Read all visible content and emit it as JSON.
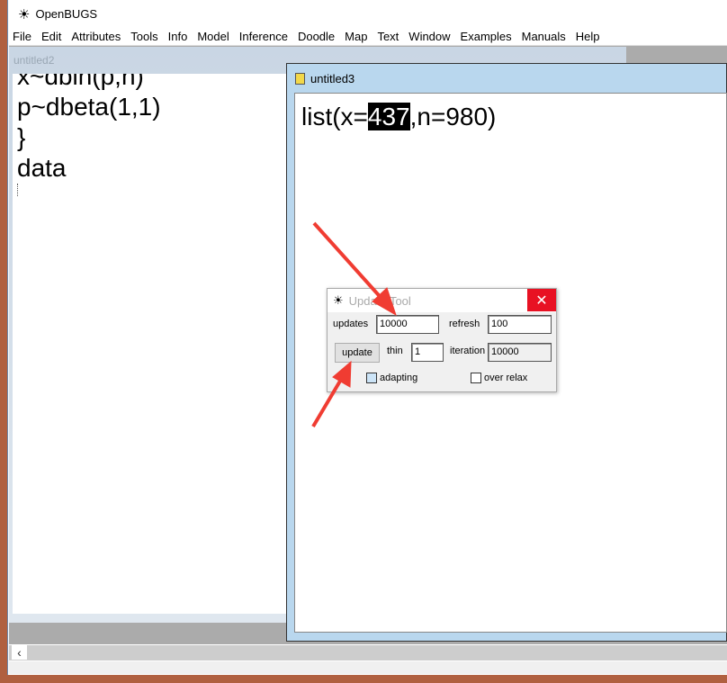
{
  "app": {
    "title": "OpenBUGS",
    "icon": "bug-icon"
  },
  "menu": [
    "File",
    "Edit",
    "Attributes",
    "Tools",
    "Info",
    "Model",
    "Inference",
    "Doodle",
    "Map",
    "Text",
    "Window",
    "Examples",
    "Manuals",
    "Help"
  ],
  "window2": {
    "title": "untitled2",
    "lines": [
      "x~dbin(p,n)",
      "p~dbeta(1,1)",
      "}",
      "data"
    ]
  },
  "window3": {
    "title": "untitled3",
    "text_before": "list(x=",
    "text_selected": "437",
    "text_after": ",n=980)"
  },
  "update_tool": {
    "title": "Update Tool",
    "updates_label": "updates",
    "updates_value": "10000",
    "refresh_label": "refresh",
    "refresh_value": "100",
    "update_button": "update",
    "thin_label": "thin",
    "thin_value": "1",
    "iteration_label": "iteration",
    "iteration_value": "10000",
    "adapting_label": "adapting",
    "over_relax_label": "over relax",
    "close": "✕"
  },
  "colors": {
    "arrow": "#f03c32",
    "close": "#e81123"
  }
}
